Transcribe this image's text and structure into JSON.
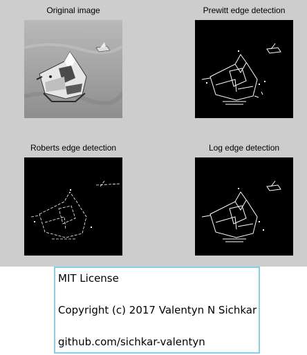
{
  "figure": {
    "panels": [
      {
        "title": "Original image",
        "kind": "grayscale"
      },
      {
        "title": "Prewitt edge detection",
        "kind": "edges"
      },
      {
        "title": "Roberts edge detection",
        "kind": "edges"
      },
      {
        "title": "Log edge detection",
        "kind": "edges"
      }
    ]
  },
  "license": {
    "line1": "MIT License",
    "line2": "Copyright (c) 2017 Valentyn N Sichkar",
    "line3": "github.com/sichkar-valentyn"
  },
  "colors": {
    "figure_bg": "#cdcdcd",
    "edge_bg": "#000000",
    "edge_fg": "#ffffff",
    "border": "#87cfe6"
  }
}
